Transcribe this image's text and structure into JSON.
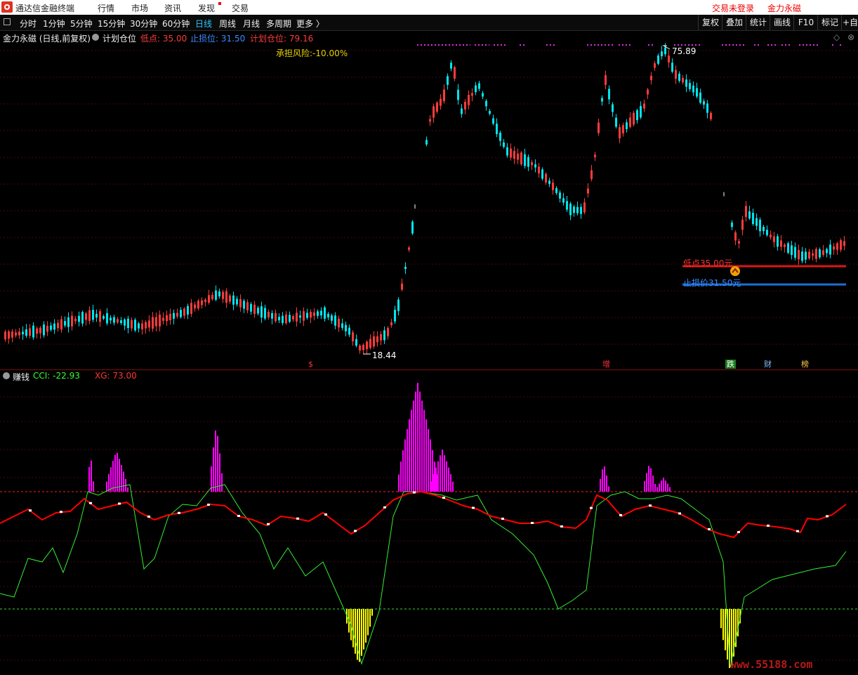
{
  "app": {
    "title": "通达信金融终端",
    "menus": [
      "行情",
      "市场",
      "资讯",
      "发现",
      "交易"
    ],
    "login_status": "交易未登录",
    "username": "金力永磁"
  },
  "toolbar": {
    "periods": [
      "分时",
      "1分钟",
      "5分钟",
      "15分钟",
      "30分钟",
      "60分钟",
      "日线",
      "周线",
      "月线",
      "多周期",
      "更多 〉"
    ],
    "active_period": "日线",
    "right_buttons": [
      "复权",
      "叠加",
      "统计",
      "画线",
      "F10",
      "标记",
      "+自"
    ]
  },
  "price_panel": {
    "stock_title": "金力永磁 (日线,前复权)",
    "indicator_name": "计划仓位",
    "low_label": "低点: 35.00",
    "stop_label": "止损位: 31.50",
    "plan_label": "计划仓位: 79.16",
    "risk_label": "承担风险:-10.00%",
    "high_marker": "75.89",
    "low_marker": "18.44",
    "low_line_label": "低点35.00元",
    "stop_line_label": "止损价31.50元",
    "event_markers": [
      "$",
      "增",
      "跌",
      "财",
      "榜"
    ]
  },
  "indicator_panel": {
    "name": "赚钱",
    "cci_label": "CCI: -22.93",
    "xg_label": "XG: 73.00"
  },
  "watermark": "www.55188.com",
  "colors": {
    "up": "#ff3b3b",
    "down": "#00e5ee",
    "magenta": "#ff00ff",
    "yellow": "#ffff00",
    "green": "#33ff33",
    "red_line": "#ff0000",
    "stop_blue": "#1a6fd6",
    "low_red": "#d81818",
    "active_tab": "#28c8ff"
  }
}
